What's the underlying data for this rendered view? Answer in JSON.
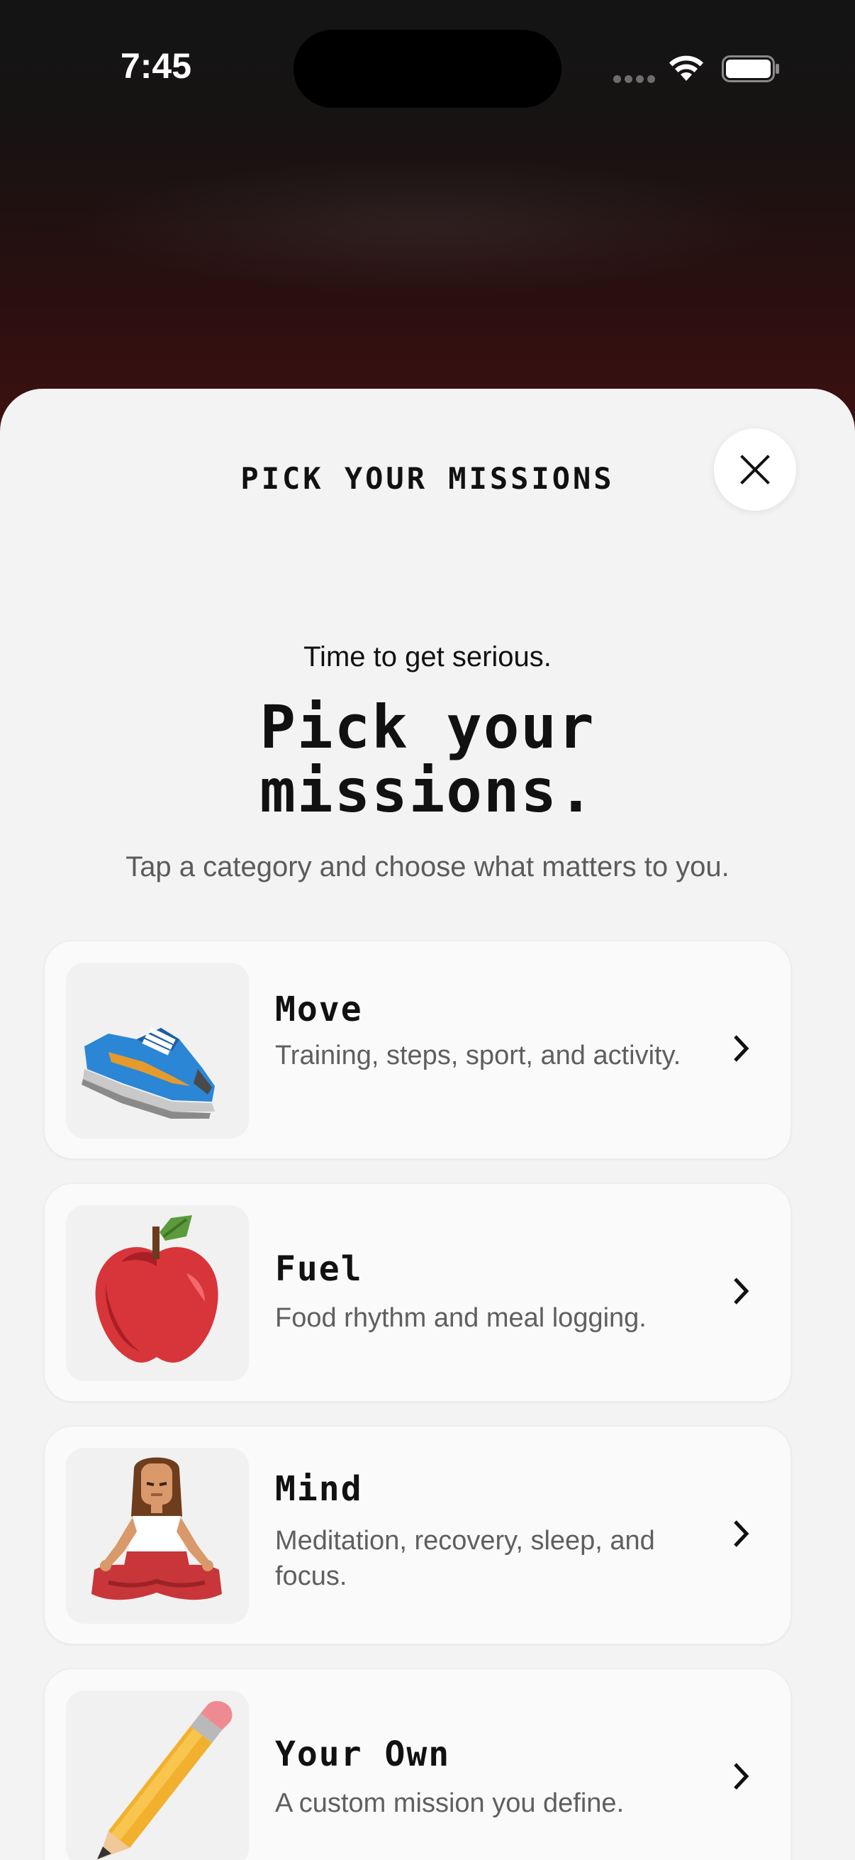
{
  "status_bar": {
    "time": "7:45"
  },
  "sheet": {
    "title": "PICK YOUR MISSIONS",
    "close_icon": "close-icon",
    "kicker": "Time to get serious.",
    "headline_line1": "Pick your",
    "headline_line2": "missions.",
    "subtitle": "Tap a category and choose what matters to you."
  },
  "categories": [
    {
      "title": "Move",
      "description": "Training, steps, sport, and activity.",
      "icon": "sneaker-icon"
    },
    {
      "title": "Fuel",
      "description": "Food rhythm and meal logging.",
      "icon": "apple-icon"
    },
    {
      "title": "Mind",
      "description": "Meditation, recovery, sleep, and focus.",
      "icon": "meditating-person-icon"
    },
    {
      "title": "Your Own",
      "description": "A custom mission you define.",
      "icon": "pencil-icon"
    }
  ]
}
